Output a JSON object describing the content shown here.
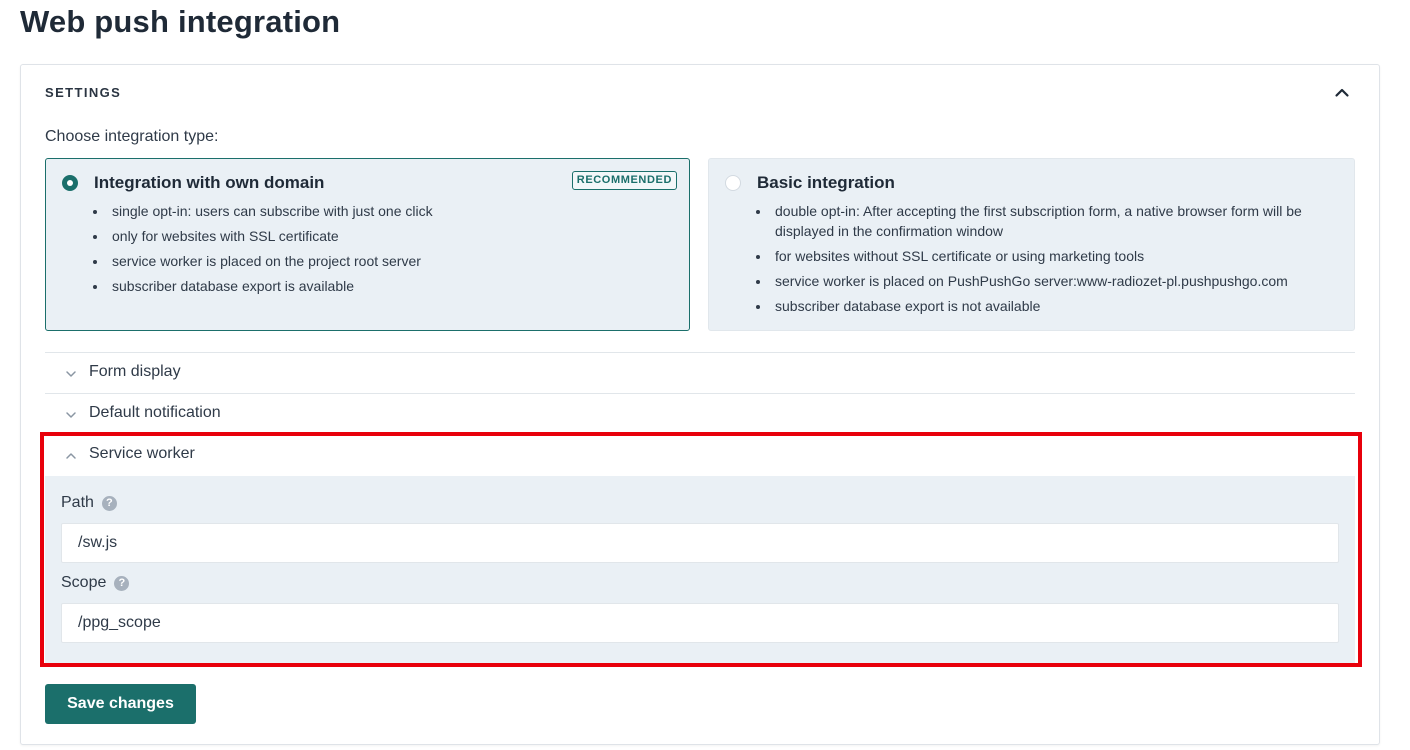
{
  "page": {
    "title": "Web push integration"
  },
  "settings": {
    "header": "SETTINGS",
    "choose_label": "Choose integration type:",
    "options": [
      {
        "title": "Integration with own domain",
        "badge": "RECOMMENDED",
        "selected": true,
        "features": [
          "single opt-in: users can subscribe with just one click",
          "only for websites with SSL certificate",
          "service worker is placed on the project root server",
          "subscriber database export is available"
        ]
      },
      {
        "title": "Basic integration",
        "selected": false,
        "features": [
          "double opt-in: After accepting the first subscription form, a native browser form will be displayed in the confirmation window",
          "for websites without SSL certificate or using marketing tools",
          "service worker is placed on PushPushGo server:www-radiozet-pl.pushpushgo.com",
          "subscriber database export is not available"
        ]
      }
    ],
    "accordions": {
      "form_display": {
        "label": "Form display",
        "expanded": false
      },
      "default_notification": {
        "label": "Default notification",
        "expanded": false
      },
      "service_worker": {
        "label": "Service worker",
        "expanded": true,
        "path_label": "Path",
        "path_value": "/sw.js",
        "scope_label": "Scope",
        "scope_value": "/ppg_scope",
        "help_glyph": "?"
      }
    },
    "save_label": "Save changes"
  },
  "colors": {
    "accent": "#1b6f6b",
    "panel_bg": "#eaf0f5",
    "highlight": "#e8000b"
  }
}
